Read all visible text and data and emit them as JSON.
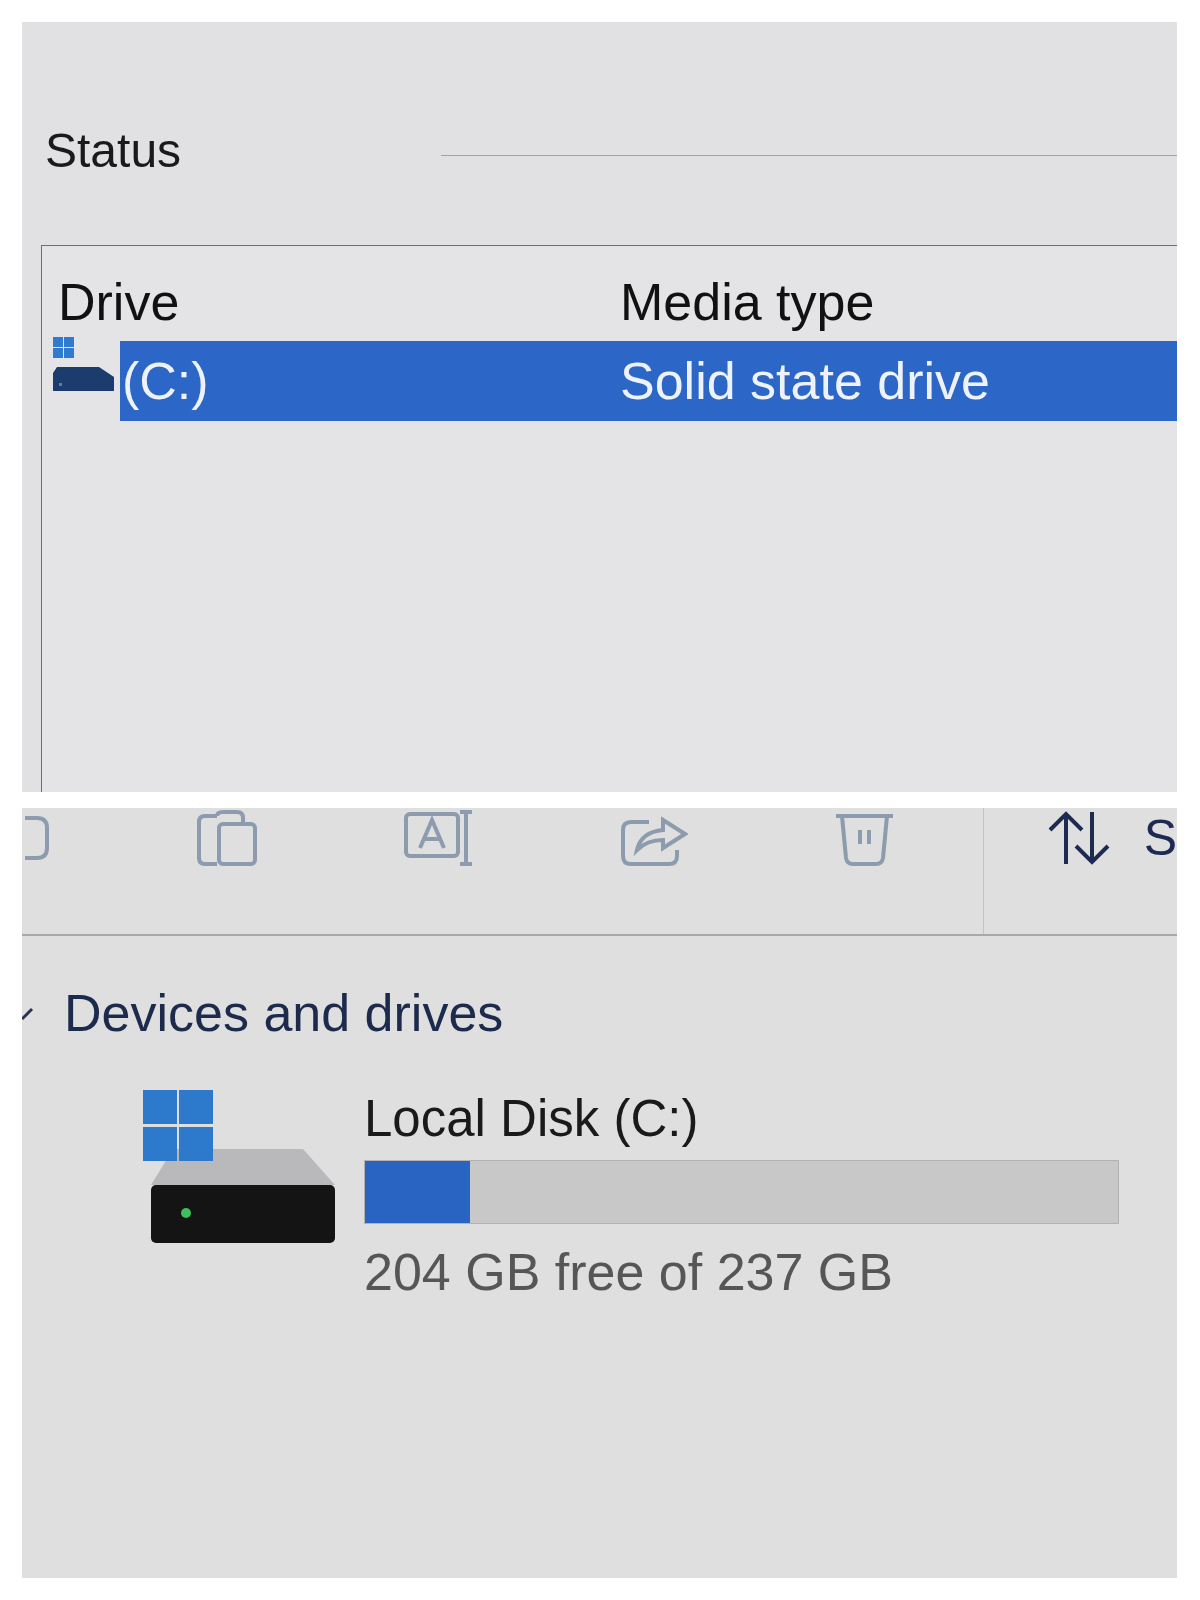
{
  "top_panel": {
    "heading": "Status",
    "list": {
      "columns": [
        "Drive",
        "Media type"
      ],
      "rows": [
        {
          "drive": "(C:)",
          "media_type": "Solid state drive",
          "selected": true
        }
      ]
    }
  },
  "bottom_panel": {
    "toolbar": [
      {
        "kind": "edge",
        "disabled": true
      },
      {
        "kind": "copy",
        "disabled": true
      },
      {
        "kind": "rename",
        "disabled": true
      },
      {
        "kind": "share",
        "disabled": true
      },
      {
        "kind": "delete",
        "disabled": true
      },
      {
        "kind": "sort",
        "label": "S",
        "disabled": false
      }
    ],
    "section": {
      "title": "Devices and drives",
      "expanded": true,
      "drives": [
        {
          "name": "Local Disk (C:)",
          "level": 0.14,
          "reading": "204 GB free of 237 GB"
        }
      ]
    }
  }
}
